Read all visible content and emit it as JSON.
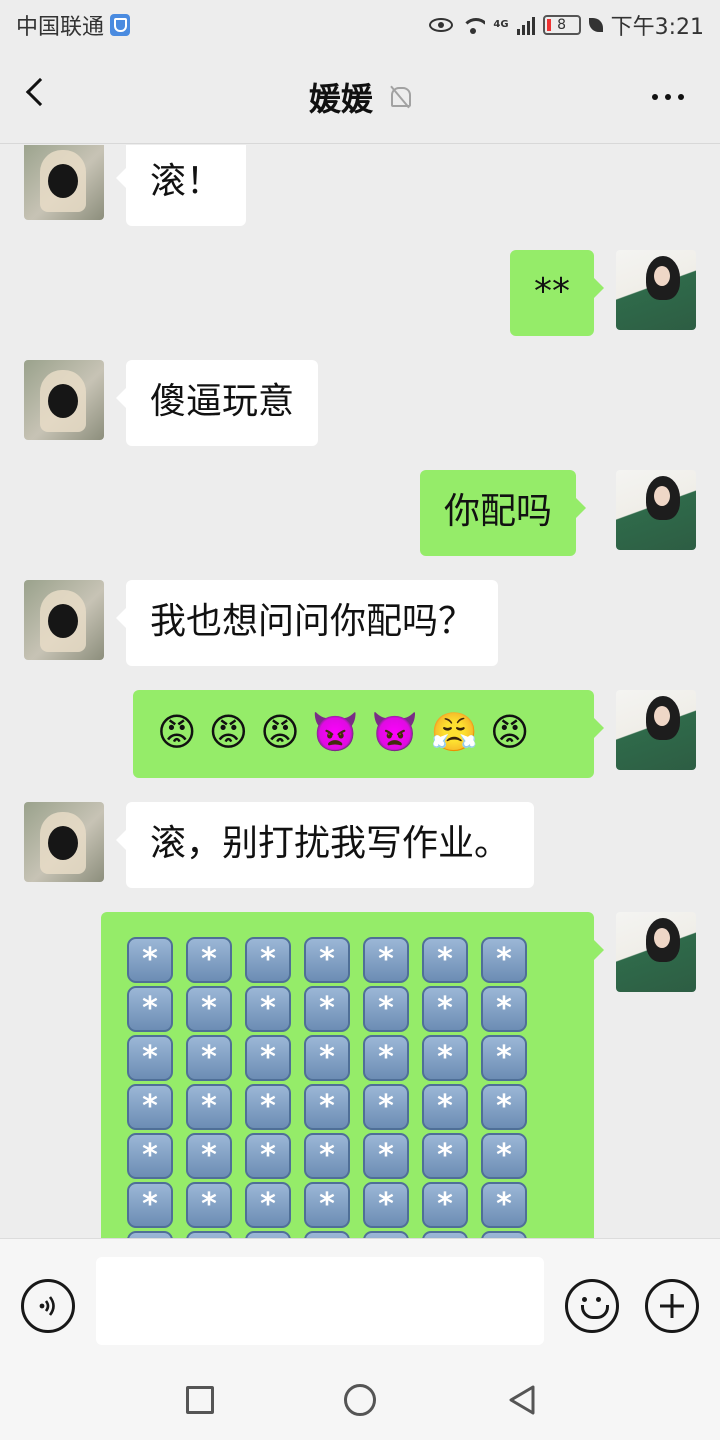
{
  "status": {
    "carrier": "中国联通",
    "network": "4G",
    "battery": "8",
    "time": "下午3:21"
  },
  "header": {
    "title": "媛媛"
  },
  "messages": [
    {
      "side": "left",
      "text": "滚！"
    },
    {
      "side": "right",
      "text": "**"
    },
    {
      "side": "left",
      "text": "傻逼玩意"
    },
    {
      "side": "right",
      "text": "你配吗"
    },
    {
      "side": "left",
      "text": "我也想问问你配吗？"
    },
    {
      "side": "right",
      "emojis": [
        "😡",
        "😡",
        "😡",
        "👿",
        "👿",
        "😤",
        "😡"
      ]
    },
    {
      "side": "left",
      "text": "滚，别打扰我写作业。"
    },
    {
      "side": "right",
      "keycap_symbol": "*",
      "keycap_icon": "asterisk-keycap-icon"
    }
  ],
  "input": {
    "placeholder": ""
  },
  "icons": {
    "voice": "voice-icon",
    "emoji": "emoji-icon",
    "plus": "plus-icon",
    "back": "back-icon",
    "more": "more-icon",
    "mute": "mute-bell-icon"
  },
  "colors": {
    "sent_bubble": "#95ec69",
    "received_bubble": "#ffffff",
    "background": "#ededed"
  }
}
